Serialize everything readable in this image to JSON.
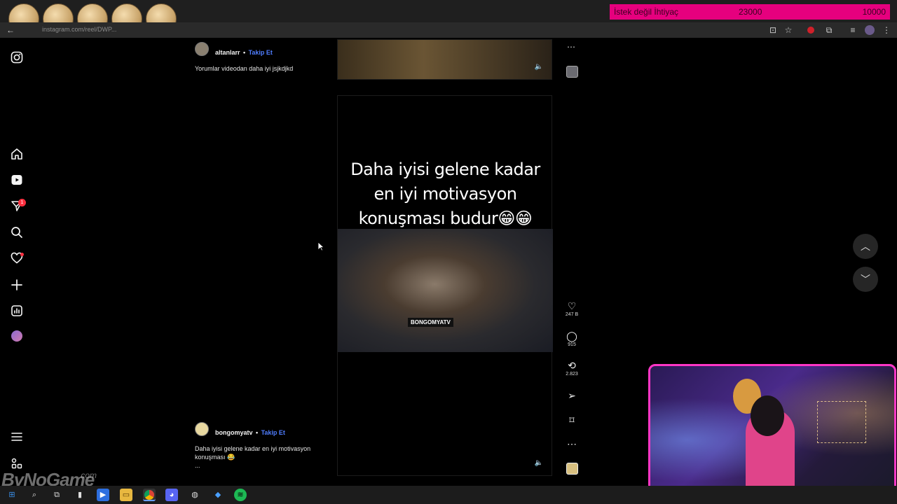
{
  "browser": {
    "tab_title": "Instagram",
    "url": "instagram.com/reel/DWP...",
    "donation_goal": {
      "label": "İstek değil İhtiyaç",
      "current": "23000",
      "target": "10000"
    }
  },
  "sidebar": {
    "items": [
      "instagram",
      "home",
      "reels",
      "messages",
      "search",
      "notifications",
      "create",
      "dashboard",
      "profile",
      "more",
      "also-from-meta"
    ],
    "messages_badge": "1"
  },
  "post1": {
    "username": "altanlarr",
    "separator": "•",
    "follow_label": "Takip Et",
    "caption": "Yorumlar videodan daha iyi jsjkdjkd"
  },
  "post2": {
    "username": "bongomyatv",
    "separator": "•",
    "follow_label": "Takip Et",
    "caption_line1": "Daha iyisi gelene kadar en iyi motivasyon",
    "caption_line2": "konuşması 😂",
    "caption_more": "...",
    "video_text": "Daha iyisi gelene kadar en iyi motivasyon konuşması budur😁😁",
    "watermark": "BONGOMYATV",
    "likes": "247 B",
    "comments": "915",
    "shares": "2.823"
  },
  "overlay": {
    "logo_text": "ByNoGame",
    "logo_suffix": ".com"
  },
  "colors": {
    "accent": "#4f7dff",
    "goal_bar": "#e6007e",
    "cam_border": "#ff36c6",
    "badge": "#ff3040"
  }
}
